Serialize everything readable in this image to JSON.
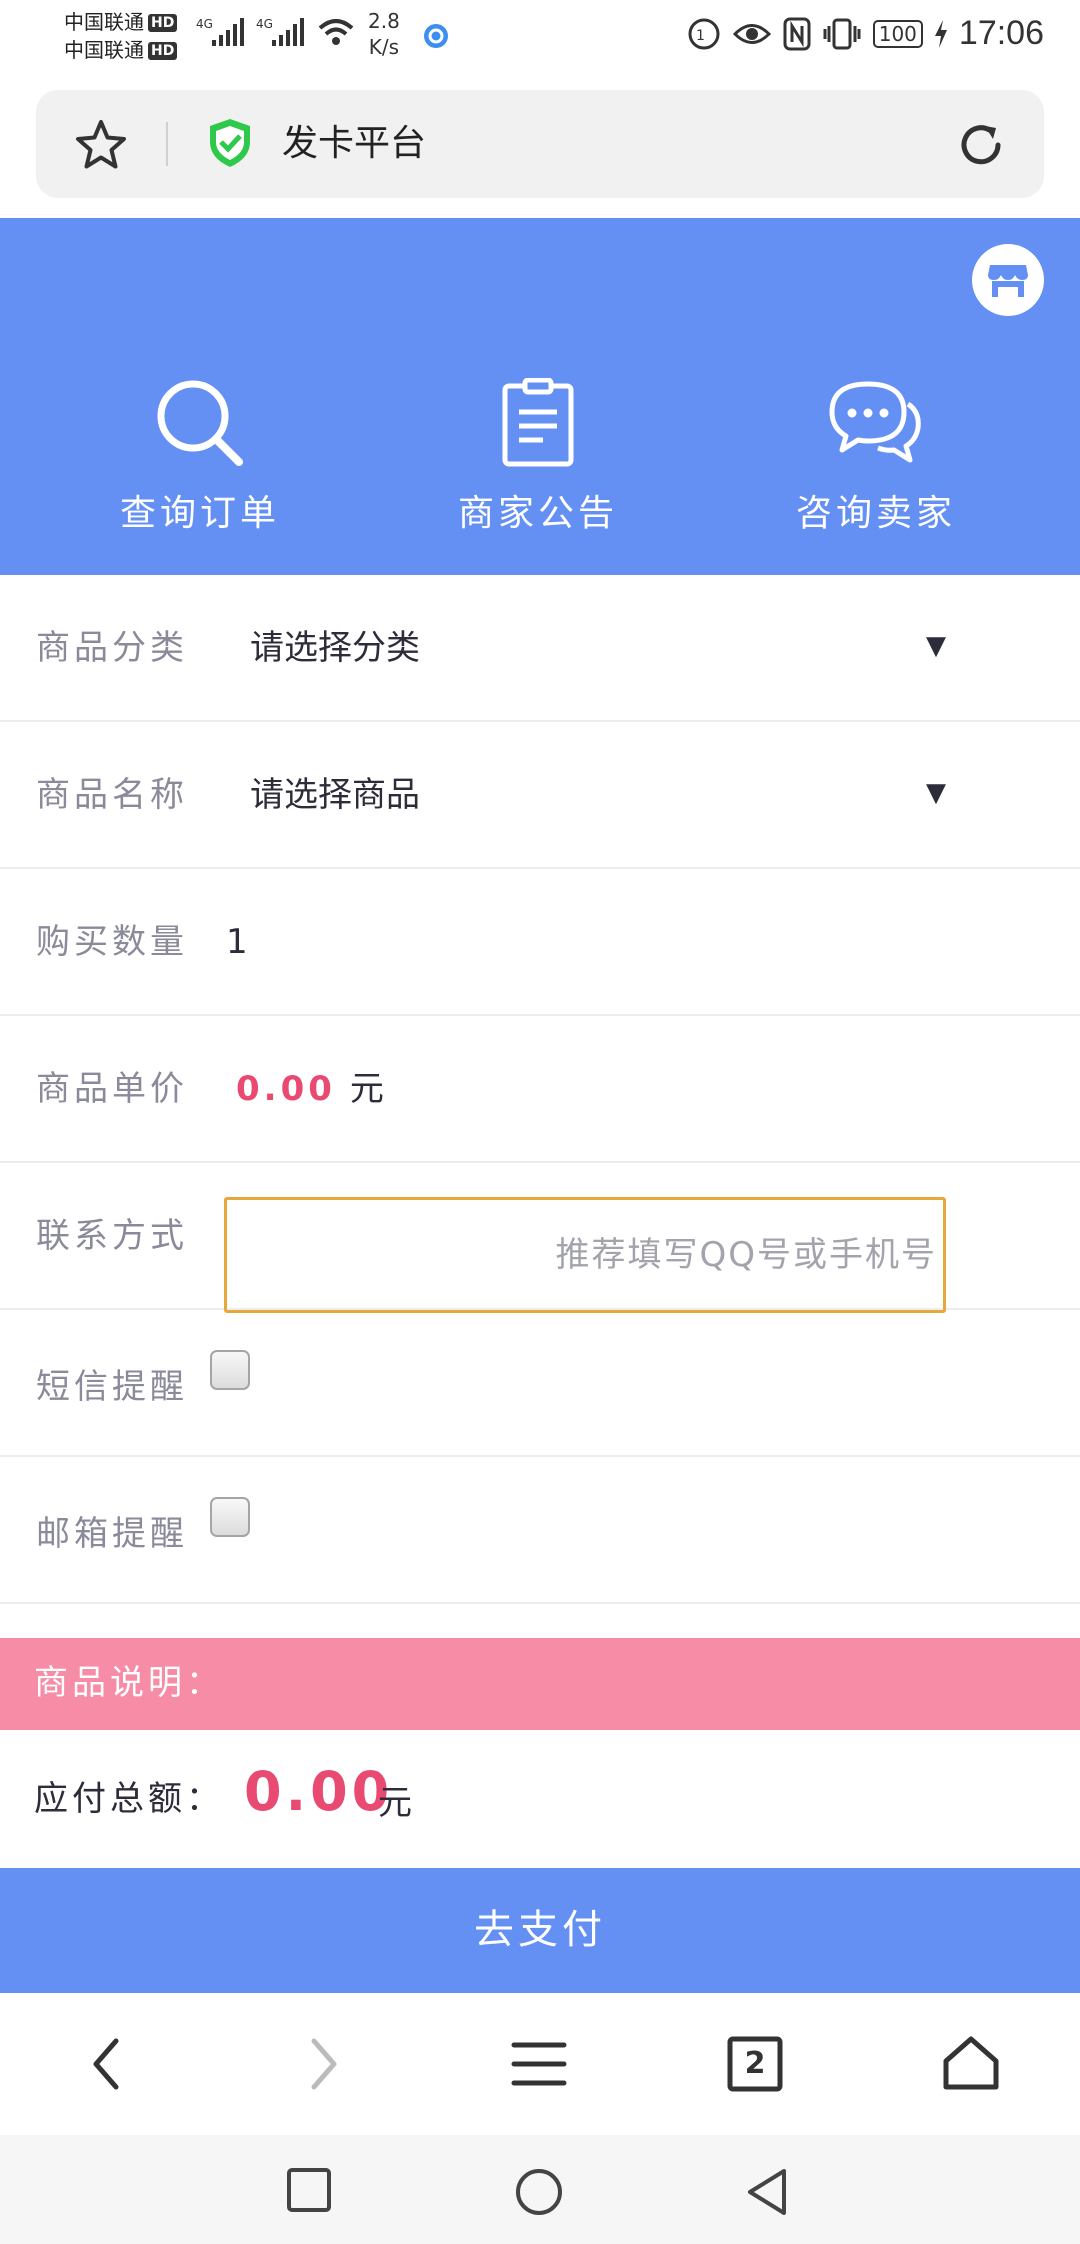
{
  "status_bar": {
    "carrier1": "中国联通",
    "carrier2": "中国联通",
    "hd_badge": "HD",
    "net_type": "4G",
    "net_speed_value": "2.8",
    "net_speed_unit": "K/s",
    "battery": "100",
    "time": "17:06"
  },
  "address_bar": {
    "title": "发卡平台"
  },
  "hero": {
    "items": [
      {
        "label": "查询订单"
      },
      {
        "label": "商家公告"
      },
      {
        "label": "咨询卖家"
      }
    ]
  },
  "form": {
    "category_label": "商品分类",
    "category_value": "请选择分类",
    "product_label": "商品名称",
    "product_value": "请选择商品",
    "quantity_label": "购买数量",
    "quantity_value": "1",
    "price_label": "商品单价",
    "price_value": "0.00",
    "price_unit": "元",
    "contact_label": "联系方式",
    "contact_placeholder": "推荐填写QQ号或手机号",
    "sms_label": "短信提醒",
    "email_label": "邮箱提醒",
    "caret": "▼"
  },
  "description": {
    "label": "商品说明："
  },
  "total": {
    "label": "应付总额：",
    "amount": "0.00",
    "unit": "元"
  },
  "pay_button": {
    "label": "去支付"
  },
  "toolbar": {
    "tab_count": "2"
  },
  "colors": {
    "primary_blue": "#6590f3",
    "price_pink": "#e84a72",
    "desc_pink": "#f78ca6",
    "input_border": "#e6a83c"
  }
}
